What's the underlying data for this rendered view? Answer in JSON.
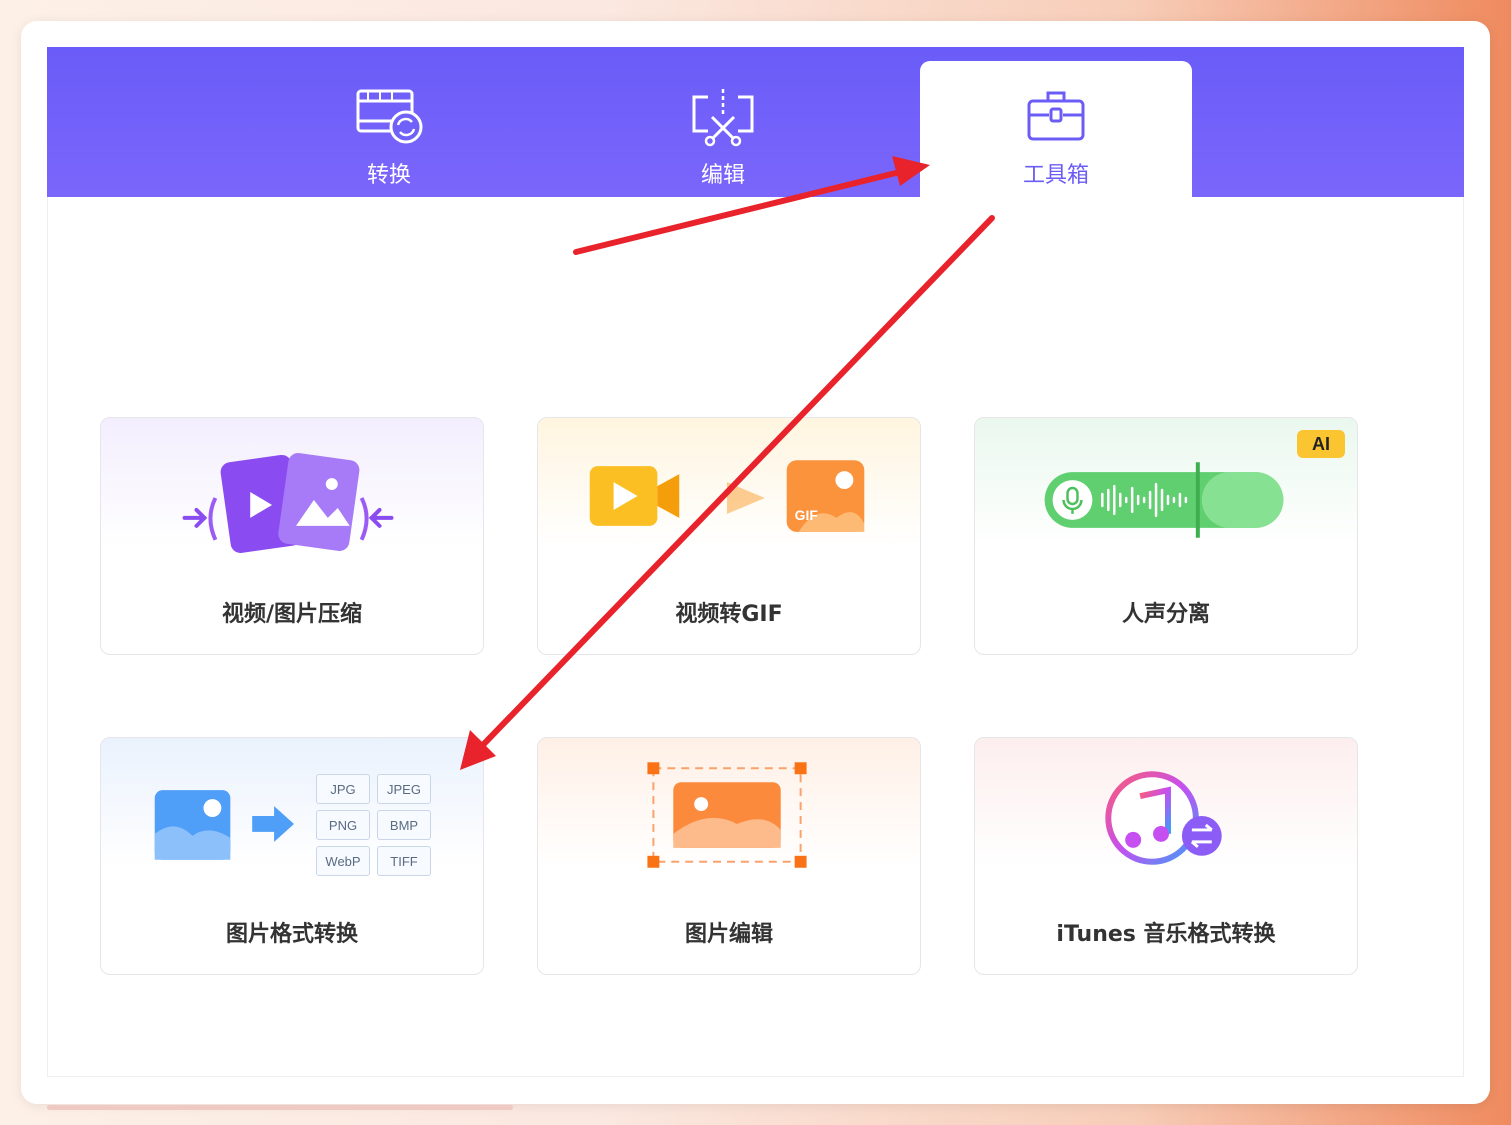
{
  "tabs": [
    {
      "label": "转换",
      "icon": "film-convert-icon",
      "active": false
    },
    {
      "label": "编辑",
      "icon": "cut-edit-icon",
      "active": false
    },
    {
      "label": "工具箱",
      "icon": "toolbox-icon",
      "active": true
    }
  ],
  "tools": [
    {
      "label": "视频/图片压缩",
      "icon": "compress-media-icon"
    },
    {
      "label": "视频转GIF",
      "icon": "video-to-gif-icon"
    },
    {
      "label": "人声分离",
      "icon": "vocal-separation-icon",
      "badge": "AI"
    },
    {
      "label": "图片格式转换",
      "icon": "image-format-icon",
      "formats": [
        "JPG",
        "JPEG",
        "PNG",
        "BMP",
        "WebP",
        "TIFF"
      ]
    },
    {
      "label": "图片编辑",
      "icon": "image-edit-icon"
    },
    {
      "label": "iTunes 音乐格式转换",
      "icon": "itunes-convert-icon"
    }
  ],
  "gif_tag": "GIF",
  "colors": {
    "header": "#6c5cf6",
    "accent": "#6c5cf6",
    "annotation_arrow": "#e8232b"
  }
}
